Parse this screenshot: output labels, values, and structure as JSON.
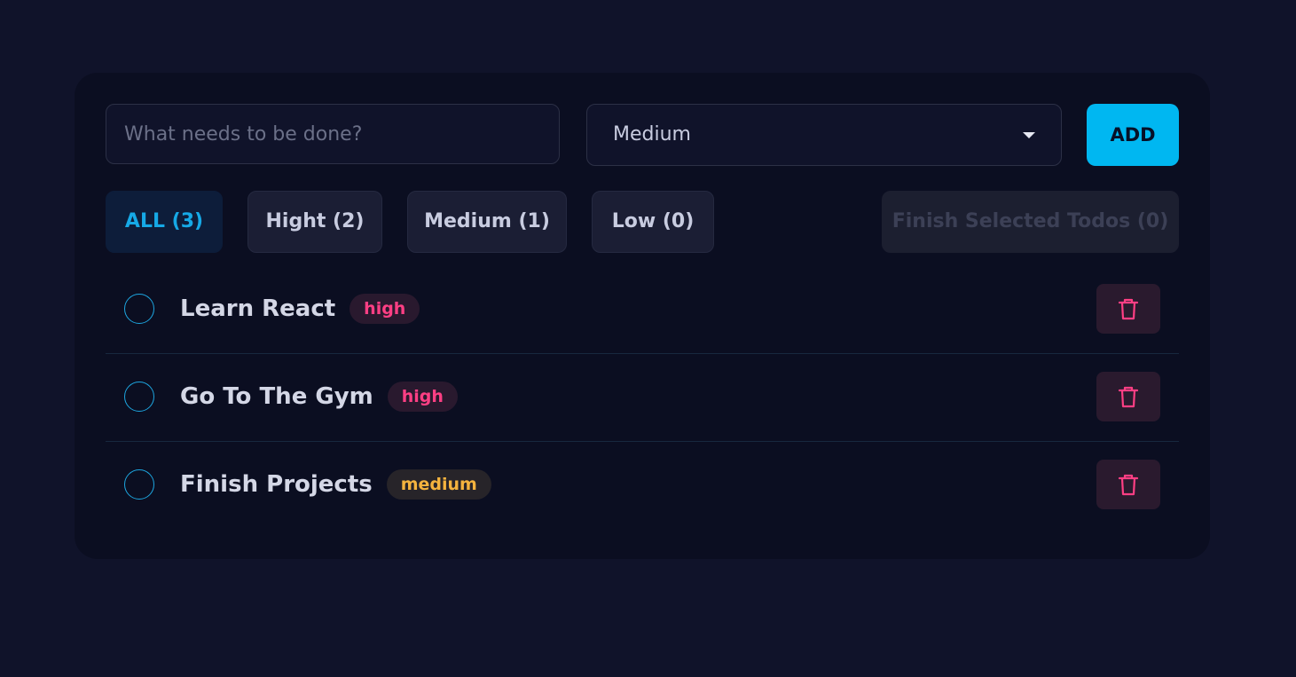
{
  "form": {
    "input_value": "",
    "input_placeholder": "What needs to be done?",
    "priority_selected": "Medium",
    "add_label": "ADD"
  },
  "filters": [
    {
      "label": "ALL (3)",
      "active": true
    },
    {
      "label": "Hight (2)",
      "active": false
    },
    {
      "label": "Medium (1)",
      "active": false
    },
    {
      "label": "Low (0)",
      "active": false
    }
  ],
  "finish_button": {
    "label": "Finish Selected Todos (0)",
    "disabled": true
  },
  "todos": [
    {
      "title": "Learn React",
      "priority": "high",
      "checked": false
    },
    {
      "title": "Go To The Gym",
      "priority": "high",
      "checked": false
    },
    {
      "title": "Finish Projects",
      "priority": "medium",
      "checked": false
    }
  ],
  "icons": {
    "dropdown": "caret-down-icon",
    "delete": "trash-icon"
  },
  "colors": {
    "background": "#10132a",
    "card": "#0b0e21",
    "accent": "#00b7f1",
    "high": "#ff3f84",
    "medium": "#f4b33e"
  }
}
